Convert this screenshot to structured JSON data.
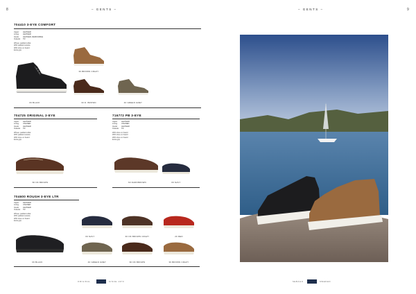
{
  "left_page": {
    "page_number": "8",
    "header": "– GENTS –",
    "products": [
      {
        "title": "704410 3-EYE COMFORT",
        "specs": [
          [
            "Upper:",
            "LEATHER"
          ],
          [
            "Lining:",
            "LEATHER"
          ],
          [
            "Insole:",
            "LEATHER, REMOVABLE"
          ],
          [
            "Outsole:",
            "TR"
          ]
        ],
        "notes": [
          "Wheat, padded collar",
          "With padded outsole",
          "With shoe on board",
          "Extra grip"
        ],
        "colors": [
          "09 BLACK",
          "39 BROWN CRAZY",
          "30 D. BROWN",
          "40 GREEN GREY"
        ]
      },
      {
        "title": "704725 ORIGINAL 3-EYE",
        "specs": [
          [
            "Upper:",
            "LEATHER"
          ],
          [
            "Lining:",
            "UNLINED"
          ],
          [
            "Insole:",
            "LEATHER"
          ],
          [
            "Outsole:",
            "TR"
          ]
        ],
        "notes": [
          "Wheat, padded collar",
          "With padded outsole",
          "With shoe on board",
          "Extra grip"
        ],
        "colors": [
          "60 DK BROWN"
        ]
      },
      {
        "title": "716772 PB 3-EYE",
        "specs": [
          [
            "Upper:",
            "LEATHER"
          ],
          [
            "Lining:",
            "UNLINED"
          ],
          [
            "Insole:",
            "LEATHER"
          ],
          [
            "Outsole:",
            "TR"
          ]
        ],
        "notes": [
          "With shoe on board",
          "With shoe on board",
          "With shoe on board",
          "Extra grip"
        ],
        "colors": [
          "60 DARKBROWN",
          "09 NAVY"
        ]
      },
      {
        "title": "704600 ROUGH 3-EYE LTR",
        "specs": [
          [
            "Upper:",
            "LEATHER"
          ],
          [
            "Lining:",
            "UNLINED"
          ],
          [
            "Insole:",
            "LEATHER"
          ],
          [
            "Outsole:",
            "TR"
          ]
        ],
        "notes": [
          "Wheat, padded collar",
          "With padded outsole",
          "With shoe on board",
          "Extra grip"
        ],
        "colors": [
          "09 BLACK",
          "09 NAVY",
          "40 GREEN GREY",
          "30 DK BROWN CRAZY",
          "60 DK BROWN",
          "20 RED",
          "39 BROWN CRAZY"
        ]
      }
    ],
    "footer_left": "ORIGINAL",
    "footer_right": "SINCE 1970"
  },
  "right_page": {
    "page_number": "9",
    "header": "– GENTS –",
    "footer_left": "SEBAGO",
    "footer_right": "SWEDEN"
  },
  "colors": {
    "black": "#1c1c1e",
    "brown_crazy": "#9a6a3f",
    "dark_brown": "#4a2a1b",
    "green_grey": "#6f6550",
    "navy": "#262c3f",
    "red": "#b8281e",
    "sky_top": "#2d4f8c",
    "sky_bottom": "#a8bad4",
    "sea": "#3e6e96",
    "rock": "#8a7d74"
  }
}
